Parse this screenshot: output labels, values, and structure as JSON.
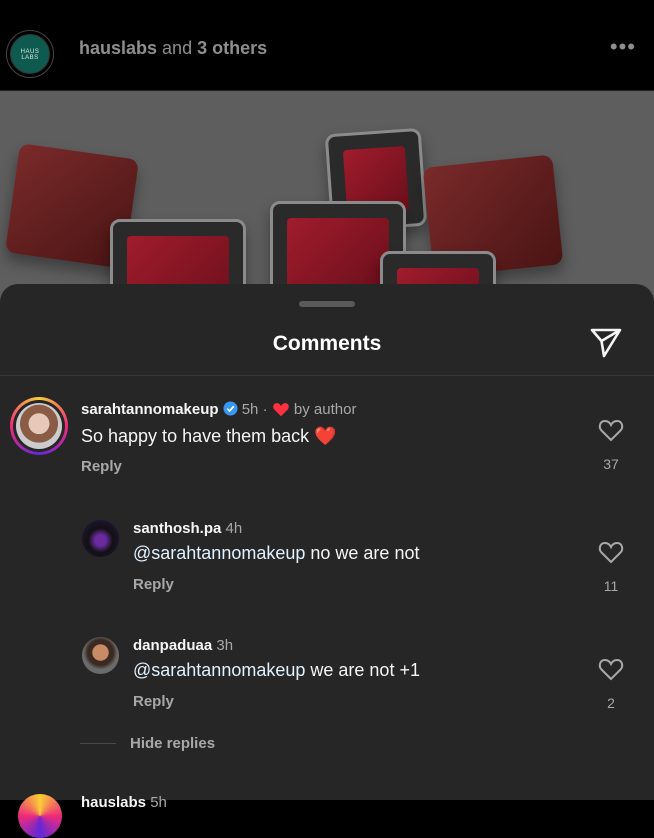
{
  "post": {
    "username": "hauslabs",
    "others_prefix": "and",
    "others_count": "3 others",
    "logo_text": "HAUS LABS",
    "more": "•••"
  },
  "sheet": {
    "title": "Comments"
  },
  "comments": [
    {
      "username": "sarahtannomakeup",
      "verified": true,
      "time": "5h",
      "separator": "·",
      "liked_by": "by author",
      "text": "So happy to have them back",
      "emoji": "❤️",
      "reply": "Reply",
      "likes": "37"
    },
    {
      "username": "santhosh.pa",
      "time": "4h",
      "mention": "@sarahtannomakeup",
      "text": " no we are not",
      "reply": "Reply",
      "likes": "11"
    },
    {
      "username": "danpaduaa",
      "time": "3h",
      "mention": "@sarahtannomakeup",
      "text": " we are not +1",
      "reply": "Reply",
      "likes": "2"
    }
  ],
  "hide_replies": "Hide replies",
  "next_comment": {
    "username": "hauslabs",
    "time": "5h"
  },
  "colors": {
    "sheet_bg": "#262626",
    "verified": "#3897f0",
    "heart": "#ff3040"
  }
}
